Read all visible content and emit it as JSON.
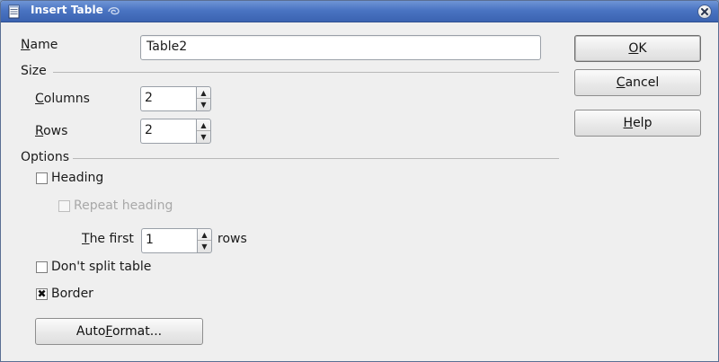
{
  "window": {
    "title": "Insert Table"
  },
  "name_field": {
    "label_prefix": "",
    "label_underlined": "N",
    "label_rest": "ame",
    "value": "Table2"
  },
  "size_section": {
    "title": "Size",
    "columns": {
      "label_underlined": "C",
      "label_rest": "olumns",
      "value": "2"
    },
    "rows": {
      "label_underlined": "R",
      "label_rest": "ows",
      "value": "2"
    }
  },
  "options_section": {
    "title": "Options",
    "heading": {
      "label": "Heading",
      "checked": false
    },
    "repeat_heading": {
      "label": "Repeat heading",
      "checked": false,
      "enabled": false
    },
    "the_first": {
      "label_underlined": "T",
      "label_rest": "he first",
      "value": "1",
      "suffix": "rows"
    },
    "dont_split": {
      "label": "Don't split table",
      "checked": false
    },
    "border": {
      "label": "Border",
      "checked": true,
      "check_mark": "✖"
    },
    "autoformat": {
      "label_prefix": "Auto",
      "label_underlined": "F",
      "label_rest": "ormat..."
    }
  },
  "buttons": {
    "ok": {
      "label_underlined": "O",
      "label_rest": "K"
    },
    "cancel": {
      "label_underlined": "C",
      "label_rest": "ancel"
    },
    "help": {
      "label_underlined": "H",
      "label_rest": "elp"
    }
  },
  "icons": {
    "spin_up": "▲",
    "spin_down": "▼"
  }
}
